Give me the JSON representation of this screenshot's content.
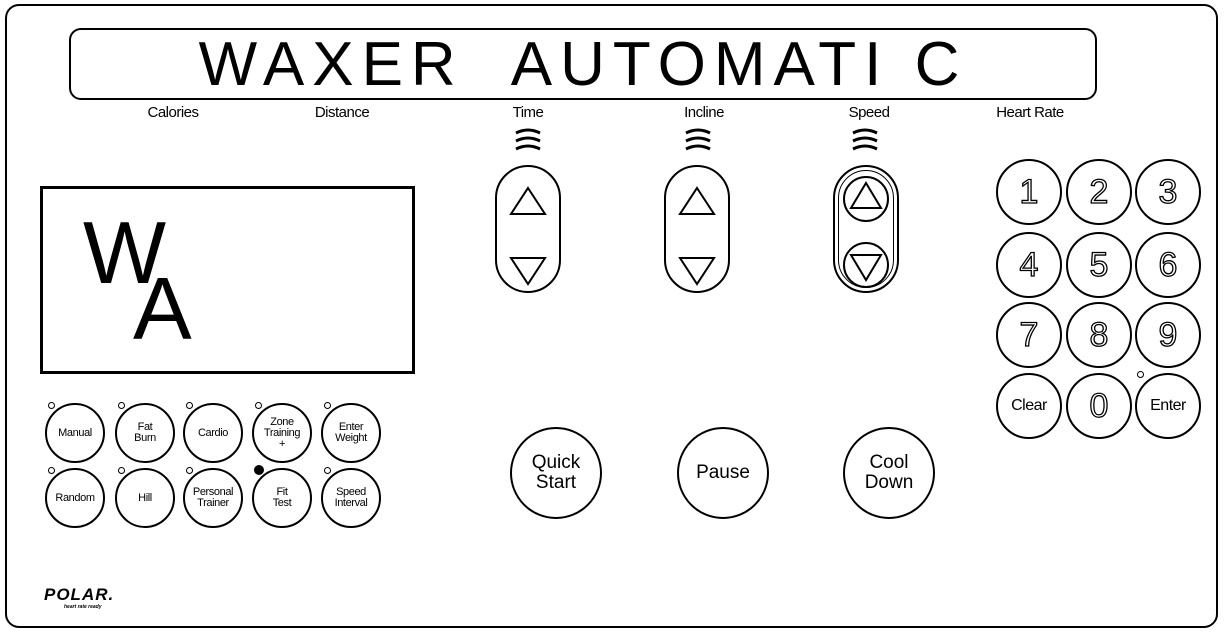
{
  "marquee": {
    "text": "WAXER  AUTOMATI C"
  },
  "labels": {
    "calories": "Calories",
    "distance": "Distance",
    "time": "Time",
    "incline": "Incline",
    "speed": "Speed",
    "heart_rate": "Heart Rate"
  },
  "display": {
    "line1": "W",
    "line2": "A"
  },
  "programs": {
    "manual": "Manual",
    "fat_burn": "Fat\nBurn",
    "cardio": "Cardio",
    "zone_training": "Zone\nTraining\n+",
    "enter_weight": "Enter\nWeight",
    "random": "Random",
    "hill": "Hill",
    "personal_trainer": "Personal\nTrainer",
    "fit_test": "Fit\nTest",
    "speed_interval": "Speed\nInterval"
  },
  "controls": {
    "quick_start": "Quick\nStart",
    "pause": "Pause",
    "cool_down": "Cool\nDown"
  },
  "keypad": {
    "k1": "1",
    "k2": "2",
    "k3": "3",
    "k4": "4",
    "k5": "5",
    "k6": "6",
    "k7": "7",
    "k8": "8",
    "k9": "9",
    "clear": "Clear",
    "k0": "0",
    "enter": "Enter"
  },
  "logo": {
    "brand": "POLAR.",
    "tagline": "heart rate ready"
  },
  "icons": {
    "up": "triangle-up-icon",
    "down": "triangle-down-icon",
    "waves": "signal-waves-icon",
    "led": "indicator-led-icon"
  },
  "colors": {
    "ink": "#000000",
    "background": "#ffffff"
  }
}
